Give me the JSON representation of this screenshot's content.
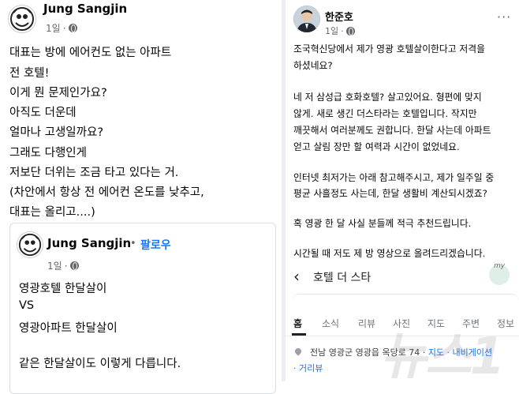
{
  "left_post": {
    "author": "Jung Sangjin",
    "time": "1일",
    "lines": [
      "대표는 방에 에어컨도 없는 아파트",
      "전 호텔!",
      "이게 뭔 문제인가요?",
      "아직도 더운데",
      "얼마나 고생일까요?",
      "그래도 다행인게",
      "저보단 더위는 조금 타고 있다는 거.",
      "(차안에서 항상 전 에어컨 온도를 낮추고,",
      "대표는 올리고....)"
    ],
    "shared": {
      "author": "Jung Sangjin",
      "separator": "•",
      "follow": "팔로우",
      "time": "1일",
      "lines": [
        "영광호텔 한달살이",
        "VS",
        "영광아파트 한달살이",
        "같은 한달살이도 이렇게 다릅니다."
      ]
    }
  },
  "right_post": {
    "author": "한준호",
    "time": "1일",
    "more": "···",
    "lines": [
      "조국혁신당에서 제가 영광 호텔살이한다고 저격을",
      "하셨네요?",
      "",
      "네 저 삼성급 호화호텔? 살고있어요. 형편에 맞지",
      "않게. 새로 생긴 더스타라는 호텔입니다. 작지만",
      "깨끗해서 여러분께도 권합니다.  한달 사는데 아파트",
      "얻고 살림 장만 할 여력과 시간이 없었네요.",
      "",
      "인터넷 최저가는 아래 참고해주시고, 제가 일주일 중",
      "평균 사흘정도 사는데, 한달 생활비 계산되시겠죠?",
      "",
      "혹 영광 한 달 사실 분들께 적극 추천드립니다.",
      "",
      "시간될 때 저도 제 방 영상으로 올려드리겠습니다."
    ],
    "map": {
      "title": "호텔 더 스타",
      "badge": "my",
      "tabs": [
        "홈",
        "소식",
        "리뷰",
        "사진",
        "지도",
        "주변",
        "정보"
      ],
      "address": "전남 영광군 영광읍 옥당로 74",
      "address_links": "지도 · 내비게이션",
      "street_link": "· 거리뷰"
    }
  },
  "watermark": "뉴스1"
}
